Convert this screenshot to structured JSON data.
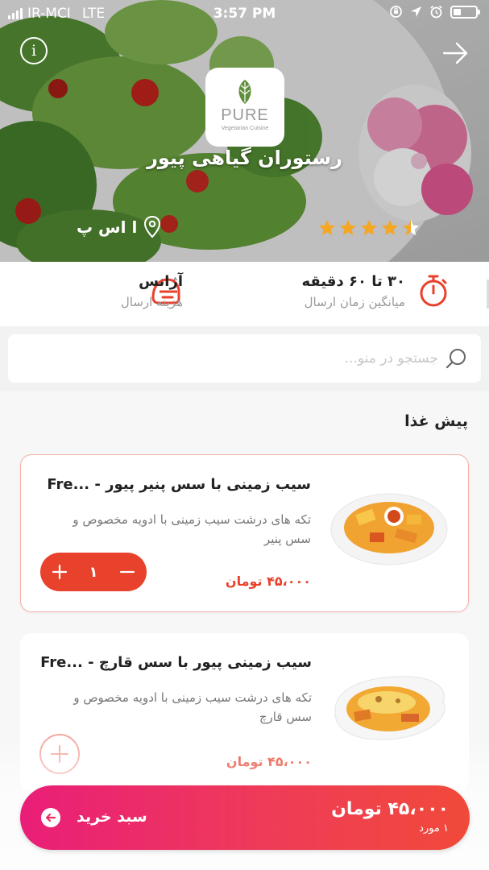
{
  "statusbar": {
    "carrier": "IR-MCI",
    "network": "LTE",
    "time": "3:57 PM"
  },
  "restaurant": {
    "name": "رستوران گیاهی پیور",
    "logo_brand": "PURE",
    "logo_sub": "Vegetarian Cuisine",
    "location": "ا اس پ",
    "rating": 4.5
  },
  "info": {
    "delivery_time_value": "۳۰ تا ۶۰ دقیقه",
    "delivery_time_label": "میانگین زمان ارسال",
    "delivery_fee_value": "آژانس",
    "delivery_fee_label": "هزینه ارسال"
  },
  "search": {
    "placeholder": "جستجو در منو..."
  },
  "menu": {
    "section_title": "پیش غذا",
    "items": [
      {
        "title": "سیب زمینی با سس پنیر پیور - ...Fre",
        "desc": "تکه های درشت سیب زمینی با ادویه مخصوص و سس پنیر",
        "price": "۴۵،۰۰۰ تومان",
        "quantity": "۱"
      },
      {
        "title": "سیب زمینی پیور با سس قارچ - ...Fre",
        "desc": "تکه های درشت سیب زمینی با ادویه مخصوص و سس قارچ",
        "price": "۴۵،۰۰۰ تومان"
      }
    ]
  },
  "cart": {
    "total": "۴۵،۰۰۰ تومان",
    "count": "۱ مورد",
    "label": "سبد خرید"
  },
  "colors": {
    "accent": "#e8412c",
    "cart_gradient_start": "#e91e78",
    "cart_gradient_end": "#f04a3a"
  }
}
